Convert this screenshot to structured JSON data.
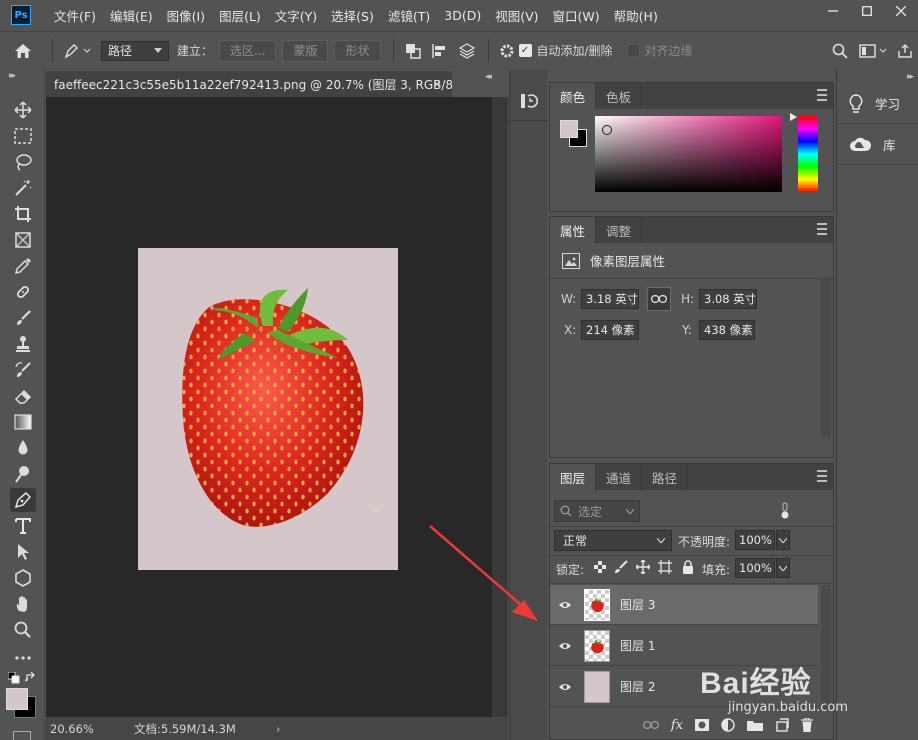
{
  "app": {
    "logo": "Ps",
    "menu": [
      "文件(F)",
      "编辑(E)",
      "图像(I)",
      "图层(L)",
      "文字(Y)",
      "选择(S)",
      "滤镜(T)",
      "3D(D)",
      "视图(V)",
      "窗口(W)",
      "帮助(H)"
    ],
    "window_controls": [
      "minimize-icon",
      "maximize-icon",
      "close-icon"
    ]
  },
  "options_bar": {
    "mode_select": "路径",
    "build_label": "建立：",
    "selection_btn": "选区...",
    "mask_btn": "蒙版",
    "shape_btn": "形状",
    "auto_add_delete": "自动添加/删除",
    "align_edges": "对齐边缘"
  },
  "document": {
    "tab_title": "faeffeec221c3c55e5b11a22ef792413.png @ 20.7% (图层 3, RGB/8) *",
    "close_symbol": "×",
    "zoom": "20.66%",
    "doc_info": "文档:5.59M/14.3M",
    "canvas_color": "#d5c6c9"
  },
  "color_panel": {
    "tabs": [
      "颜色",
      "色板"
    ],
    "foreground": "#d5c6c9",
    "background": "#000000",
    "hue_field": "#e0157a"
  },
  "properties_panel": {
    "tabs": [
      "属性",
      "调整"
    ],
    "section_title": "像素图层属性",
    "w_label": "W:",
    "w_value": "3.18 英寸",
    "h_label": "H:",
    "h_value": "3.08 英寸",
    "x_label": "X:",
    "x_value": "214 像素",
    "y_label": "Y:",
    "y_value": "438 像素"
  },
  "layers_panel": {
    "tabs": [
      "图层",
      "通道",
      "路径"
    ],
    "filter_placeholder": "选定",
    "blend_mode": "正常",
    "opacity_label": "不透明度:",
    "opacity_value": "100%",
    "lock_label": "锁定:",
    "fill_label": "填充:",
    "fill_value": "100%",
    "layers": [
      {
        "name": "图层 3",
        "selected": true
      },
      {
        "name": "图层 1",
        "selected": false
      },
      {
        "name": "图层 2",
        "selected": false
      }
    ]
  },
  "right_strip": {
    "learn": "学习",
    "library": "库"
  },
  "watermark": {
    "brand": "Bai经验",
    "url": "jingyan.baidu.com"
  }
}
